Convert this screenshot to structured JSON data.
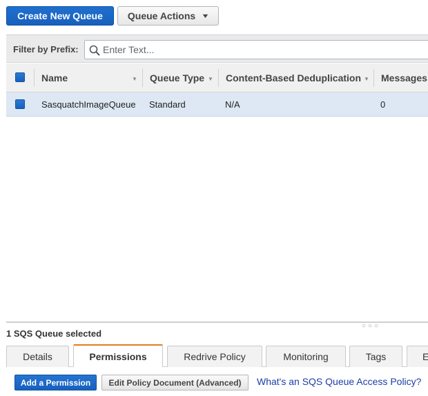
{
  "toolbar": {
    "create_label": "Create New Queue",
    "actions_label": "Queue Actions"
  },
  "filter": {
    "label": "Filter by Prefix:",
    "placeholder": "Enter Text..."
  },
  "table": {
    "columns": [
      {
        "label": "Name"
      },
      {
        "label": "Queue Type"
      },
      {
        "label": "Content-Based Deduplication"
      },
      {
        "label": "Messages"
      }
    ],
    "rows": [
      {
        "name": "SasquatchImageQueue",
        "type": "Standard",
        "dedup": "N/A",
        "messages": "0",
        "selected": true
      }
    ]
  },
  "details": {
    "selected_text": "1 SQS Queue selected",
    "tabs": [
      {
        "label": "Details"
      },
      {
        "label": "Permissions",
        "active": true
      },
      {
        "label": "Redrive Policy"
      },
      {
        "label": "Monitoring"
      },
      {
        "label": "Tags"
      },
      {
        "label": "E"
      }
    ],
    "add_permission_label": "Add a Permission",
    "edit_policy_label": "Edit Policy Document (Advanced)",
    "help_link": "What's an SQS Queue Access Policy?"
  },
  "colors": {
    "primary": "#1f6fd0",
    "row_selected": "#dde8f4",
    "tab_active_accent": "#e07b18",
    "link": "#1a3ea8"
  }
}
